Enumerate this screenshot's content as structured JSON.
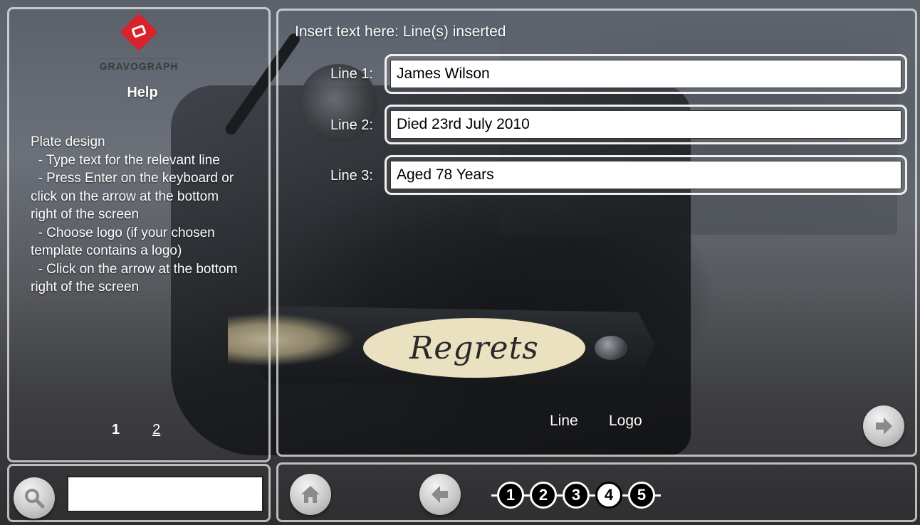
{
  "brand": {
    "name": "GRAVOGRAPH",
    "accent": "#d6242a"
  },
  "help": {
    "title": "Help",
    "heading": "Plate design",
    "lines": [
      "- Type text for the relevant line",
      "- Press Enter on the keyboard or click on the arrow at the bottom right of the screen",
      "- Choose logo (if your chosen template contains a logo)",
      "- Click on the arrow at the bottom right of the screen"
    ],
    "pages": [
      "1",
      "2"
    ],
    "current_page": "1"
  },
  "search": {
    "value": "",
    "icon": "magnifier-icon"
  },
  "main": {
    "header": "Insert text here:  Line(s) inserted",
    "lines": [
      {
        "label": "Line 1:",
        "value": "James Wilson"
      },
      {
        "label": "Line 2:",
        "value": "Died 23rd July 2010"
      },
      {
        "label": "Line 3:",
        "value": "Aged 78 Years"
      }
    ],
    "modes": {
      "line": "Line",
      "logo": "Logo"
    },
    "background_plaque_text": "Regrets"
  },
  "nav": {
    "home_icon": "home-icon",
    "back_icon": "left-arrow-icon",
    "next_icon": "right-arrow-icon",
    "steps": [
      "1",
      "2",
      "3",
      "4",
      "5"
    ],
    "current_step": "4"
  }
}
